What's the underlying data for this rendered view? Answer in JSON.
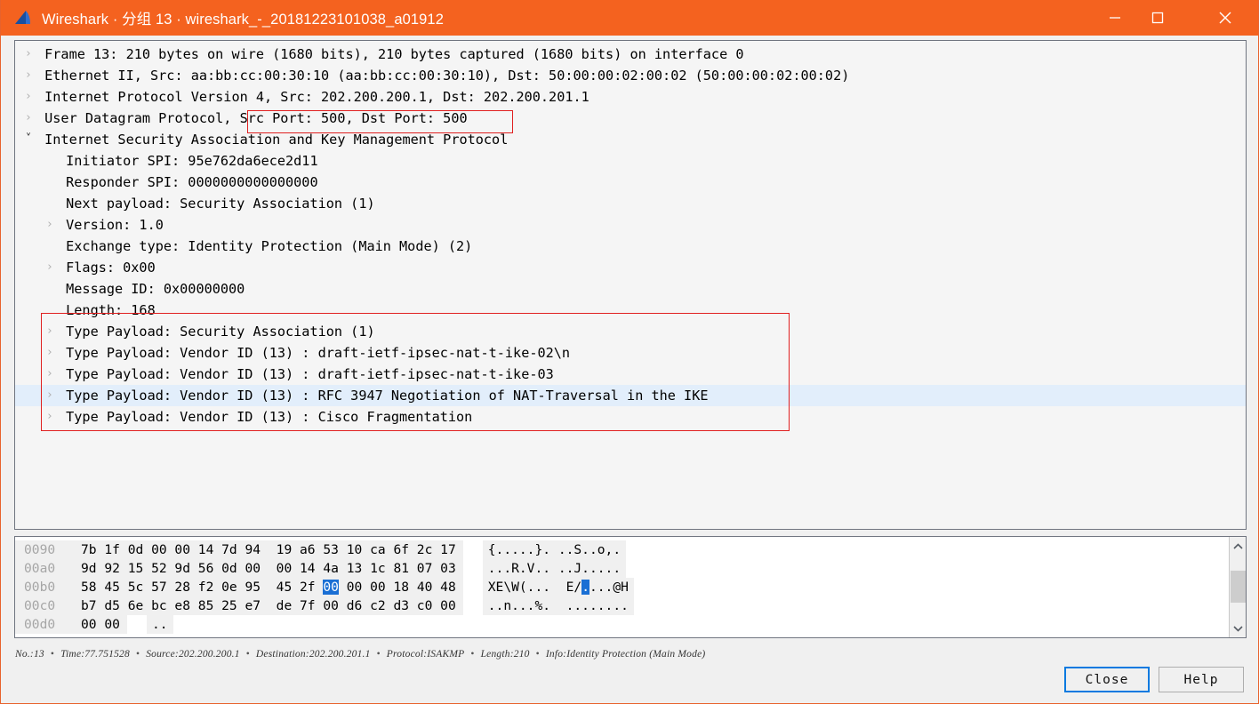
{
  "window": {
    "title": "Wireshark · 分组 13 · wireshark_-_20181223101038_a01912",
    "icon": "wireshark-fin-icon",
    "accent_color": "#f4621f",
    "controls": {
      "minimize": "minimize-icon",
      "maximize": "maximize-icon",
      "close": "close-icon"
    }
  },
  "detail_tree": {
    "rows": [
      {
        "twisty": "collapsed",
        "indent": 0,
        "text": "Frame 13: 210 bytes on wire (1680 bits), 210 bytes captured (1680 bits) on interface 0"
      },
      {
        "twisty": "collapsed",
        "indent": 0,
        "text": "Ethernet II, Src: aa:bb:cc:00:30:10 (aa:bb:cc:00:30:10), Dst: 50:00:00:02:00:02 (50:00:00:02:00:02)"
      },
      {
        "twisty": "collapsed",
        "indent": 0,
        "text": "Internet Protocol Version 4, Src: 202.200.200.1, Dst: 202.200.201.1"
      },
      {
        "twisty": "collapsed",
        "indent": 0,
        "text": "User Datagram Protocol, Src Port: 500, Dst Port: 500"
      },
      {
        "twisty": "expanded",
        "indent": 0,
        "text": "Internet Security Association and Key Management Protocol"
      },
      {
        "twisty": "none",
        "indent": 1,
        "text": "Initiator SPI: 95e762da6ece2d11"
      },
      {
        "twisty": "none",
        "indent": 1,
        "text": "Responder SPI: 0000000000000000"
      },
      {
        "twisty": "none",
        "indent": 1,
        "text": "Next payload: Security Association (1)"
      },
      {
        "twisty": "collapsed",
        "indent": 1,
        "text": "Version: 1.0"
      },
      {
        "twisty": "none",
        "indent": 1,
        "text": "Exchange type: Identity Protection (Main Mode) (2)"
      },
      {
        "twisty": "collapsed",
        "indent": 1,
        "text": "Flags: 0x00"
      },
      {
        "twisty": "none",
        "indent": 1,
        "text": "Message ID: 0x00000000"
      },
      {
        "twisty": "none",
        "indent": 1,
        "text": "Length: 168"
      },
      {
        "twisty": "collapsed",
        "indent": 1,
        "text": "Type Payload: Security Association (1)"
      },
      {
        "twisty": "collapsed",
        "indent": 1,
        "text": "Type Payload: Vendor ID (13) : draft-ietf-ipsec-nat-t-ike-02\\n"
      },
      {
        "twisty": "collapsed",
        "indent": 1,
        "text": "Type Payload: Vendor ID (13) : draft-ietf-ipsec-nat-t-ike-03"
      },
      {
        "twisty": "collapsed",
        "indent": 1,
        "text": "Type Payload: Vendor ID (13) : RFC 3947 Negotiation of NAT-Traversal in the IKE",
        "selected": true
      },
      {
        "twisty": "collapsed",
        "indent": 1,
        "text": "Type Payload: Vendor ID (13) : Cisco Fragmentation"
      }
    ],
    "annotations": {
      "ports_box_color": "#e02020",
      "payloads_box_color": "#e02020",
      "selection_color": "#e2eefb"
    }
  },
  "hex_dump": {
    "selection_color": "#1a6fd4",
    "rows": [
      {
        "offset": "0090",
        "left": "7b 1f 0d 00 00 14 7d 94",
        "right": "19 a6 53 10 ca 6f 2c 17",
        "ascii_left": "{.....}.",
        "ascii_right": "..S..o,."
      },
      {
        "offset": "00a0",
        "left": "9d 92 15 52 9d 56 0d 00",
        "right": "00 14 4a 13 1c 81 07 03",
        "ascii_left": "...R.V..",
        "ascii_right": "..J....."
      },
      {
        "offset": "00b0",
        "left": "58 45 5c 57 28 f2 0e 95",
        "right_pre": "45 2f ",
        "right_sel": "00",
        "right_post": " 00 00 18 40 48",
        "ascii_left": "XE\\W(...",
        "ascii_pre": " E/",
        "ascii_sel": ".",
        "ascii_post": "...@H"
      },
      {
        "offset": "00c0",
        "left": "b7 d5 6e bc e8 85 25 e7",
        "right": "de 7f 00 d6 c2 d3 c0 00",
        "ascii_left": "..n...%.",
        "ascii_right": " ........"
      },
      {
        "offset": "00d0",
        "left": "00 00",
        "right": "",
        "ascii_left": "..",
        "ascii_right": ""
      }
    ]
  },
  "status_bar": {
    "fields": [
      {
        "label": "No.:",
        "value": "13"
      },
      {
        "label": "Time:",
        "value": "77.751528"
      },
      {
        "label": "Source:",
        "value": "202.200.200.1"
      },
      {
        "label": "Destination:",
        "value": "202.200.201.1"
      },
      {
        "label": "Protocol:",
        "value": "ISAKMP"
      },
      {
        "label": "Length:",
        "value": "210"
      },
      {
        "label": "Info:",
        "value": "Identity Protection (Main Mode)"
      }
    ],
    "separator": "•"
  },
  "buttons": {
    "close": "Close",
    "help": "Help",
    "focus_color": "#0a7ae0"
  },
  "scrollbars": {
    "up_arrow": "chevron-up-icon",
    "down_arrow": "chevron-down-icon"
  }
}
